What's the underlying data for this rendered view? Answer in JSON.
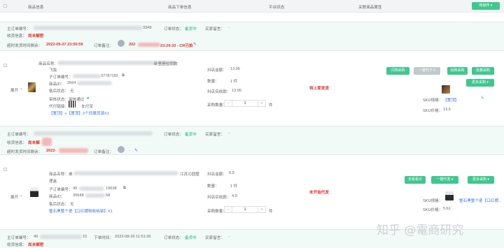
{
  "header": {
    "col_product": "商品信息",
    "col_platform_order": "商品下单信息",
    "col_platform_status": "平台状态",
    "col_related": "关联商品属性",
    "action_button": "和操作"
  },
  "orders": [
    {
      "main_order_label": "主订单编号：",
      "main_order_suffix": "3349",
      "order_status_label": "订单状态：",
      "order_status": "备货中",
      "buyer_message_label": "买家留言：",
      "buyer_message": "-",
      "receipt_label": "收货信息：",
      "receipt_value": "尚未解密",
      "timeout_label": "超时发货时间剩余：",
      "timeout_value": "2022-09-27 23:59:59",
      "remark_label": "订单备注：",
      "remark_prefix": "202",
      "remark_suffix": "23:29:33 - CR已拍",
      "expand_label": "展开",
      "product_name_label": "商品名称：",
      "product_name_suffix": "卧室座位同款",
      "product_name_line2": "飞兔",
      "sub_order_label": "子订单编号：",
      "sub_order_suffix": "37787182",
      "product_id_label": "商品ID：",
      "product_id_prefix": "3564",
      "after_sale_label": "售后状态：",
      "after_sale_value": "无",
      "audit_label": "审核状态：",
      "audit_value": "审核通过",
      "pay_label": "代付链接：",
      "pay_value": "支付宝",
      "tags": "【置顶】+【置顶】2个同属货源X1",
      "amount_label": "抖店金额：",
      "amount_value": "13.95",
      "count_label": "数量：",
      "count_value": "1 件",
      "paid_label": "抖店实收款：",
      "paid_value": "13.95",
      "purchase_qty_label": "采购数量：",
      "purchase_qty_value": "1",
      "purchase_unit": "件",
      "ship_status": "待上家发货",
      "sku_spec_label": "SKU规格：",
      "sku_spec_value": "【置顶】",
      "sku_price_label": "SKU价格：",
      "sku_price_value": "13.6",
      "buttons": [
        "闪购采购",
        "一键代下",
        "抢购采购",
        "批量采购",
        "更多采购"
      ]
    },
    {
      "main_order_label": "主订单编号：",
      "order_status_label": "订单状态：",
      "order_status": "备货中",
      "buyer_message_label": "买家留言：",
      "buyer_message": "-",
      "receipt_label": "收货信息：",
      "receipt_value": "尚未解",
      "timeout_label": "超时发货时间剩余：",
      "timeout_value": "2022-",
      "remark_label": "订单备注：",
      "remark_value": "-",
      "expand_label": "展开",
      "product_name_label": "商品名称：",
      "product_name_prefix": "桌",
      "product_name_suffix": "江苏沁园整",
      "product_name_line2": "理盒",
      "sub_order_label": "子订单编号：",
      "sub_order_prefix": "49",
      "sub_order_suffix": "19638",
      "product_id_label": "商品ID：",
      "product_id_prefix": "35648",
      "product_id_suffix": "58",
      "after_sale_label": "售后状态：",
      "after_sale_value": "无",
      "tags": "整石黑整个瓷【口红摆物收纳架】X1",
      "amount_label": "抖店金额：",
      "amount_value": "5.9",
      "count_label": "数量：",
      "count_value": "1 件",
      "paid_label": "抖店实收款：",
      "paid_value": "4.9",
      "purchase_qty_label": "采购数量：",
      "purchase_qty_value": "1",
      "purchase_unit": "件",
      "ship_status": "未开始代发",
      "sku_spec_label": "SKU规格：",
      "sku_spec_value": "整石黑整个瓷【口红摆...",
      "sku_price_label": "SKU价格：",
      "sku_price_value": "5.61",
      "buttons": [
        "去看看价",
        "一键代发",
        "更多采购"
      ]
    },
    {
      "main_order_label": "主订单编号：",
      "main_order_prefix": "49",
      "main_order_suffix": "15",
      "order_time_label": "下单时间：",
      "order_time_value": "2022-08-20 11:51:36",
      "order_status_label": "订单状态：",
      "order_status": "备货中",
      "buyer_message_label": "买家留言：",
      "buyer_message": "-",
      "receipt_label": "收货信息：",
      "receipt_value": "尚未解密"
    }
  ],
  "watermark": "知乎 @電商研究"
}
